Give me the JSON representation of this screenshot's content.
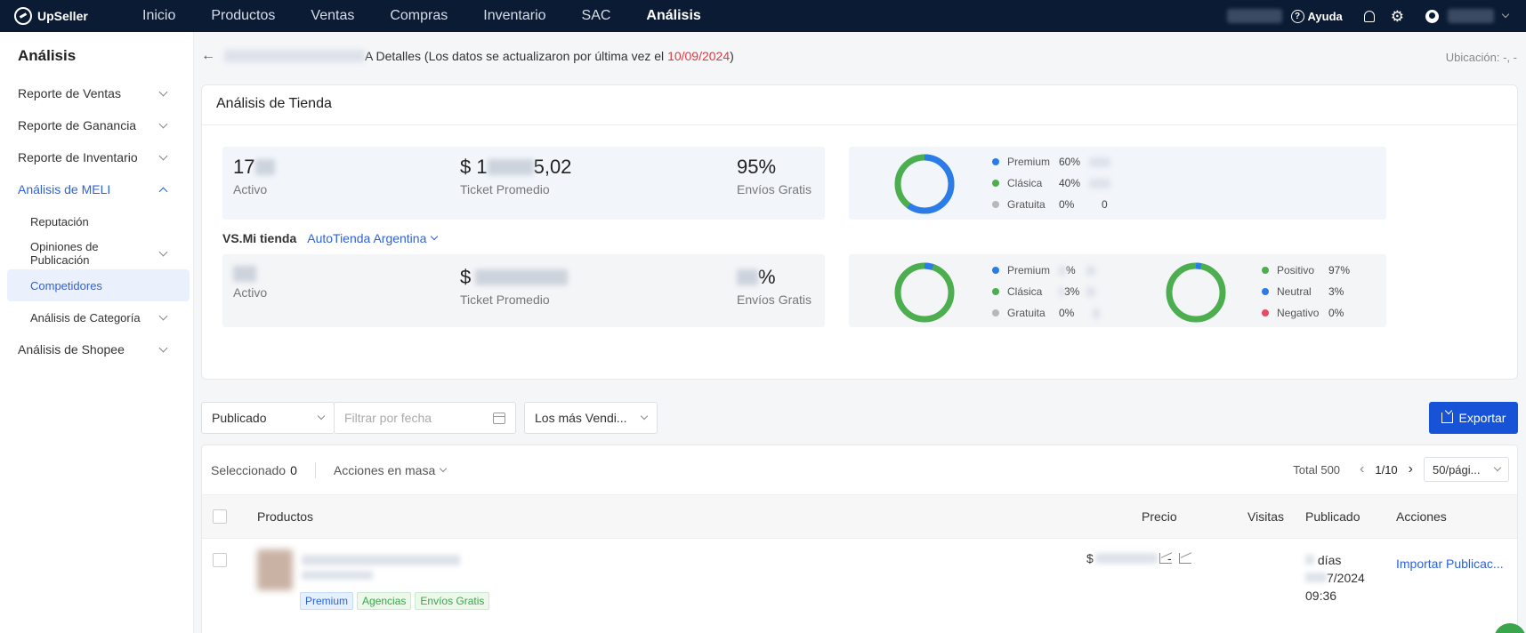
{
  "app": {
    "logo_text": "UpSeller"
  },
  "nav": [
    "Inicio",
    "Productos",
    "Ventas",
    "Compras",
    "Inventario",
    "SAC",
    "Análisis"
  ],
  "nav_active": "Análisis",
  "topbar": {
    "help_label": "Ayuda",
    "icons": [
      "question-icon",
      "bell-icon",
      "gear-icon",
      "user-icon"
    ]
  },
  "sidebar": {
    "title": "Análisis",
    "items": [
      {
        "label": "Reporte de Ventas",
        "expanded": false
      },
      {
        "label": "Reporte de Ganancia",
        "expanded": false
      },
      {
        "label": "Reporte de Inventario",
        "expanded": false
      },
      {
        "label": "Análisis de MELI",
        "expanded": true
      },
      {
        "label": "Reputación"
      },
      {
        "label": "Opiniones de Publicación",
        "expanded": false
      },
      {
        "label": "Competidores",
        "selected": true
      },
      {
        "label": "Análisis de Categoría",
        "expanded": false
      },
      {
        "label": "Análisis de Shopee",
        "expanded": false
      }
    ]
  },
  "header": {
    "crumb_suffix": "A Detalles (Los datos se actualizaron por última vez el ",
    "update_date": "10/09/2024",
    "crumb_close": ")",
    "location": "Ubicación: -, -"
  },
  "analysis": {
    "title": "Análisis de Tienda",
    "competitor": {
      "active_visible": "17",
      "active_label": "Activo",
      "ticket_prefix": "$ 1",
      "ticket_suffix": "5,02",
      "ticket_label": "Ticket Promedio",
      "free_ship": "95%",
      "free_ship_label": "Envíos Gratis",
      "listing_types": [
        {
          "name": "Premium",
          "pct": "60%",
          "value": "",
          "color": "#2b7be9"
        },
        {
          "name": "Clásica",
          "pct": "40%",
          "value": "",
          "color": "#4cae4f"
        },
        {
          "name": "Gratuita",
          "pct": "0%",
          "value": "0",
          "color": "#b8b8b8"
        }
      ]
    },
    "vs_label": "VS.Mi tienda",
    "my_store_name": "AutoTienda Argentina",
    "mine": {
      "active_label": "Activo",
      "ticket_prefix": "$",
      "ticket_label": "Ticket Promedio",
      "free_ship_suffix": "%",
      "free_ship_label": "Envíos Gratis",
      "listing_types": [
        {
          "name": "Premium",
          "pct": "%",
          "color": "#2b7be9"
        },
        {
          "name": "Clásica",
          "pct": "3%",
          "color": "#4cae4f"
        },
        {
          "name": "Gratuita",
          "pct": "0%",
          "color": "#b8b8b8"
        }
      ],
      "reputation": [
        {
          "name": "Positivo",
          "pct": "97%",
          "color": "#4cae4f"
        },
        {
          "name": "Neutral",
          "pct": "3%",
          "color": "#2b7be9"
        },
        {
          "name": "Negativo",
          "pct": "0%",
          "color": "#e84a5f"
        }
      ]
    }
  },
  "filters": {
    "status": "Publicado",
    "date_placeholder": "Filtrar por fecha",
    "sort": "Los más Vendi...",
    "export_label": "Exportar"
  },
  "table": {
    "selected_label": "Seleccionado",
    "selected_count": "0",
    "mass_actions": "Acciones en masa",
    "total": "Total 500",
    "page": "1/10",
    "page_size": "50/pági...",
    "columns": [
      "Productos",
      "Precio",
      "Visitas",
      "Publicado",
      "Acciones"
    ],
    "rows": [
      {
        "price_prefix": "$",
        "visits": "-",
        "published_days": "días",
        "published_date": "7/2024",
        "published_time": "09:36",
        "action": "Importar Publicac...",
        "tags": [
          "Premium",
          "Agencias",
          "Envíos Gratis"
        ]
      }
    ]
  }
}
